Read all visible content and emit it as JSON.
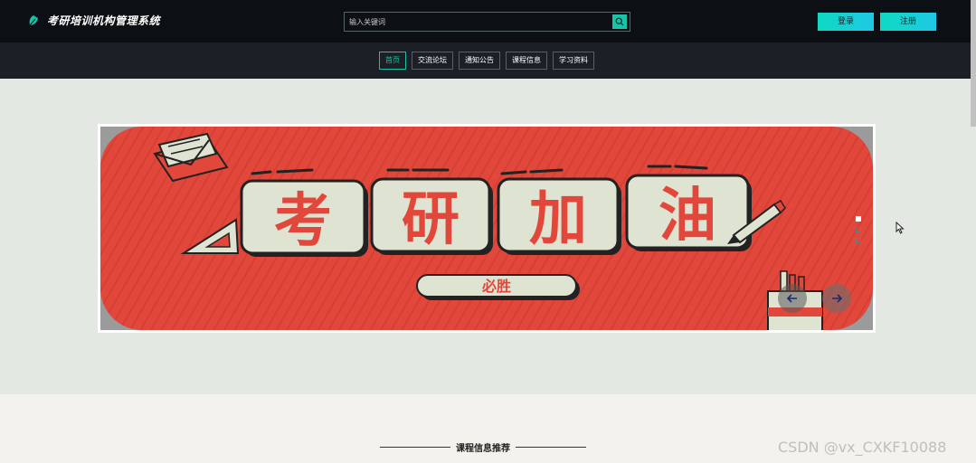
{
  "header": {
    "brand_title": "考研培训机构管理系统",
    "brand_icon": "leaf-icon",
    "search_placeholder": "输入关键词",
    "search_icon": "search-icon",
    "login_label": "登录",
    "register_label": "注册"
  },
  "nav": {
    "items": [
      {
        "label": "首页",
        "active": true
      },
      {
        "label": "交流论坛",
        "active": false
      },
      {
        "label": "通知公告",
        "active": false
      },
      {
        "label": "课程信息",
        "active": false
      },
      {
        "label": "学习资料",
        "active": false
      }
    ]
  },
  "banner": {
    "headline_chars": [
      "考",
      "研",
      "加",
      "油"
    ],
    "subtitle": "必胜",
    "prev_icon": "arrow-left-icon",
    "next_icon": "arrow-right-icon",
    "slides_total": 3,
    "active_slide": 1
  },
  "section": {
    "title": "课程信息推荐"
  },
  "watermark": "CSDN @vx_CXKF10088",
  "colors": {
    "accent": "#17c0a6",
    "header_bg": "#0c0f13",
    "nav_bg": "#1b1f26",
    "banner_red": "#e1473a",
    "banner_cream": "#dfe3d2"
  }
}
